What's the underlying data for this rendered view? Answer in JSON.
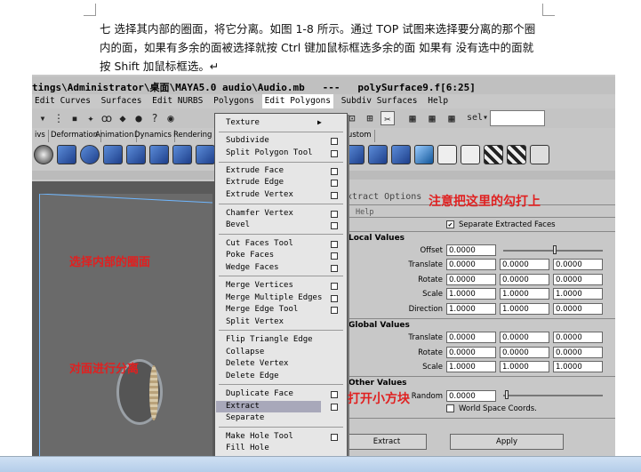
{
  "doc": {
    "line1": "七   选择其内部的圈面，将它分离。如图 1-8 所示。通过 TOP 试图来选择要分离的那个圈",
    "line2": "内的面，如果有多余的面被选择就按 Ctrl 键加鼠标框选多余的面 如果有 没有选中的面就",
    "line3": "按 Shift 加鼠标框选。↵"
  },
  "window": {
    "title": "tings\\Administrator\\桌面\\MAYA5.0 audio\\Audio.mb   ---   polySurface9.f[6:25]"
  },
  "menubar": [
    "Edit Curves",
    "Surfaces",
    "Edit NURBS",
    "Polygons",
    "Edit Polygons",
    "Subdiv Surfaces",
    "Help"
  ],
  "shelf_tabs": [
    "ivs",
    "Deformation",
    "Animation",
    "Dynamics",
    "Rendering",
    "Custom"
  ],
  "toolbar": {
    "sel_label": "sel▾"
  },
  "dropdown": {
    "texture": "Texture",
    "items": [
      "Subdivide",
      "Split Polygon Tool",
      "Extrude Face",
      "Extrude Edge",
      "Extrude Vertex",
      "Chamfer Vertex",
      "Bevel",
      "Cut Faces Tool",
      "Poke Faces",
      "Wedge Faces",
      "Merge Vertices",
      "Merge Multiple Edges",
      "Merge Edge Tool",
      "Split Vertex",
      "Flip Triangle Edge",
      "Collapse",
      "Delete Vertex",
      "Delete Edge",
      "Duplicate Face",
      "Extract",
      "Separate",
      "Make Hole Tool",
      "Fill Hole"
    ],
    "highlighted": "Extract"
  },
  "viewport": {
    "note1": "选择内部的圈面",
    "note2": "对面进行分离"
  },
  "options": {
    "title": "xtract Options",
    "help": "Help",
    "separate_label": "Separate Extracted Faces",
    "separate_checked": "✔",
    "local_values": "Local Values",
    "global_values": "Global Values",
    "other_values": "Other Values",
    "labels": {
      "offset": "Offset",
      "translate": "Translate",
      "rotate": "Rotate",
      "scale": "Scale",
      "direction": "Direction",
      "random": "Random",
      "world_space": "World Space Coords."
    },
    "local": {
      "offset": "0.0000",
      "translate": [
        "0.0000",
        "0.0000",
        "0.0000"
      ],
      "rotate": [
        "0.0000",
        "0.0000",
        "0.0000"
      ],
      "scale": [
        "1.0000",
        "1.0000",
        "1.0000"
      ],
      "direction": [
        "1.0000",
        "1.0000",
        "0.0000"
      ]
    },
    "global": {
      "translate": [
        "0.0000",
        "0.0000",
        "0.0000"
      ],
      "rotate": [
        "0.0000",
        "0.0000",
        "0.0000"
      ],
      "scale": [
        "1.0000",
        "1.0000",
        "1.0000"
      ]
    },
    "other": {
      "random": "0.0000"
    },
    "extract_button": "Extract",
    "apply_button": "Apply"
  },
  "annotations": {
    "checkbox_note": "注意把这里的勾打上",
    "box_note": "打开小方块"
  }
}
